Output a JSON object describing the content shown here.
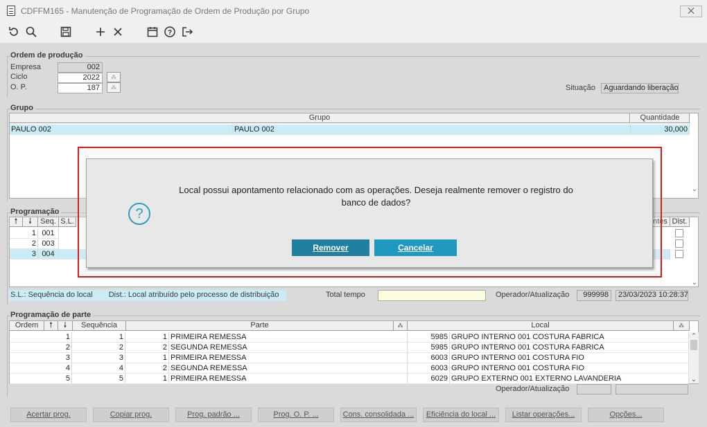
{
  "window": {
    "title": "CDFFM165 - Manutenção de Programação de Ordem de Produção por Grupo",
    "close": "⨉"
  },
  "toolbar": {
    "icons": [
      "undo-icon",
      "search-icon",
      "save-icon",
      "add-icon",
      "delete-icon",
      "calendar-icon",
      "help-icon",
      "exit-icon"
    ]
  },
  "ordem": {
    "legend": "Ordem de produção",
    "empresa_label": "Empresa",
    "empresa": "002",
    "ciclo_label": "Ciclo",
    "ciclo": "2022",
    "op_label": "O. P.",
    "op": "187",
    "situacao_label": "Situação",
    "situacao": "Aguardando liberação"
  },
  "grupo": {
    "legend": "Grupo",
    "col_grupo": "Grupo",
    "col_qtd": "Quantidade",
    "row": {
      "c1": "PAULO 002",
      "c2": "PAULO 002",
      "qtd": "30,000"
    }
  },
  "programacao": {
    "legend": "Programação",
    "col_seq": "Seq.",
    "col_sl": "S.L.",
    "col_tes": "ntes",
    "col_dist": "Dist.",
    "rows": [
      {
        "n": "1",
        "seq": "001"
      },
      {
        "n": "2",
        "seq": "003"
      },
      {
        "n": "3",
        "seq": "004"
      }
    ],
    "sl_note": "S.L.: Sequência do local",
    "dist_note": "Dist.: Local atribuído pelo processo de distribuição",
    "total_tempo_label": "Total tempo",
    "total_tempo": "",
    "op_atual_label": "Operador/Atualização",
    "operador": "999998",
    "data": "23/03/2023 10:28:37"
  },
  "parte": {
    "legend": "Programação de parte",
    "col_ordem": "Ordem",
    "col_seq": "Sequência",
    "col_parte": "Parte",
    "col_local": "Local",
    "rows": [
      {
        "ordem": "1",
        "seq": "1",
        "pn": "1",
        "parte": "PRIMEIRA REMESSA",
        "ln": "5985",
        "local": "GRUPO INTERNO 001 COSTURA FABRICA"
      },
      {
        "ordem": "2",
        "seq": "2",
        "pn": "2",
        "parte": "SEGUNDA REMESSA",
        "ln": "5985",
        "local": "GRUPO INTERNO 001 COSTURA FABRICA"
      },
      {
        "ordem": "3",
        "seq": "3",
        "pn": "1",
        "parte": "PRIMEIRA REMESSA",
        "ln": "6003",
        "local": "GRUPO INTERNO 001 COSTURA FIO"
      },
      {
        "ordem": "4",
        "seq": "4",
        "pn": "2",
        "parte": "SEGUNDA REMESSA",
        "ln": "6003",
        "local": "GRUPO INTERNO 001 COSTURA FIO"
      },
      {
        "ordem": "5",
        "seq": "5",
        "pn": "1",
        "parte": "PRIMEIRA REMESSA",
        "ln": "6029",
        "local": "GRUPO EXTERNO 001 EXTERNO LAVANDERIA"
      }
    ],
    "op_atual_label": "Operador/Atualização"
  },
  "buttons": {
    "acertar": "Acertar prog.",
    "copiar": "Copiar prog.",
    "padrao": "Prog. padrão ...",
    "prog_op": "Prog. O. P. ...",
    "cons": "Cons. consolidada ...",
    "eficiencia": "Eficiência do local ...",
    "listar": "Listar operações...",
    "opcoes": "Opções..."
  },
  "dialog": {
    "message": "Local possui apontamento relacionado com as operações. Deseja realmente remover o registro do banco de dados?",
    "icon": "?",
    "remover": "Remover",
    "cancelar": "Cancelar"
  },
  "colors": {
    "accent": "#1e8fb0",
    "selection": "#c9ecf6",
    "highlight_border": "#d81c1c"
  }
}
